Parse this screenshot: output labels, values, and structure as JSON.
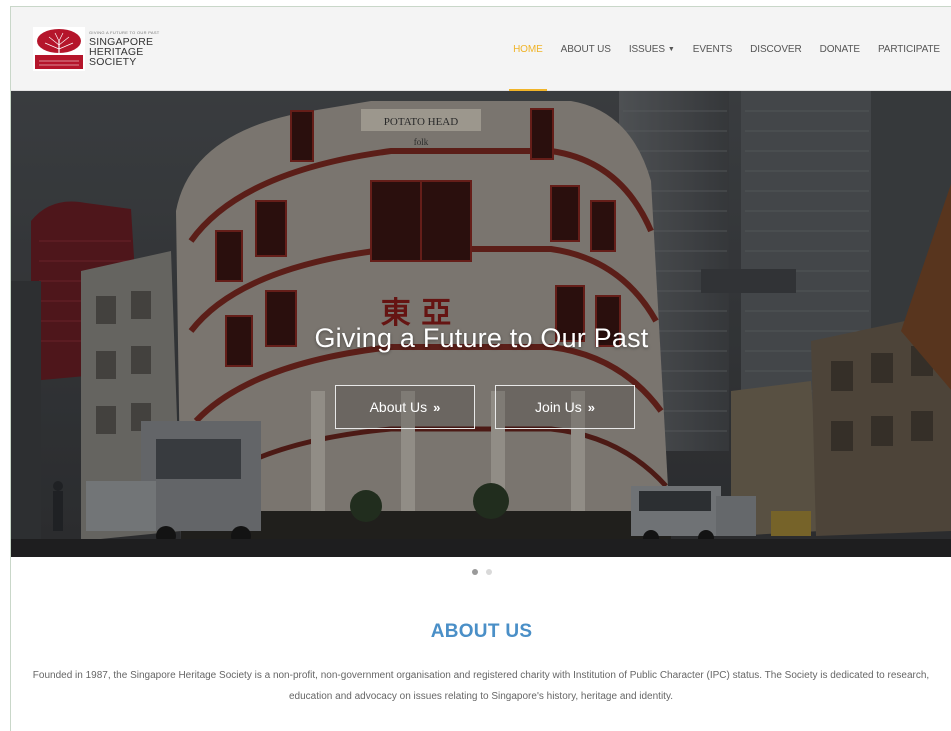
{
  "header": {
    "logo": {
      "tagline": "GIVING A FUTURE TO OUR PAST",
      "lines": [
        "SINGAPORE",
        "HERITAGE",
        "SOCIETY"
      ]
    },
    "nav": [
      {
        "label": "HOME",
        "active": true
      },
      {
        "label": "ABOUT US",
        "active": false
      },
      {
        "label": "ISSUES",
        "active": false,
        "has_dropdown": true
      },
      {
        "label": "EVENTS",
        "active": false
      },
      {
        "label": "DISCOVER",
        "active": false
      },
      {
        "label": "DONATE",
        "active": false
      },
      {
        "label": "PARTICIPATE",
        "active": false
      }
    ]
  },
  "hero": {
    "title": "Giving a Future to Our Past",
    "buttons": {
      "about": "About Us",
      "join": "Join Us"
    },
    "signs": {
      "shop": "POTATO HEAD",
      "shop_sub": "folk",
      "chinese": "東 亞"
    },
    "slides": 2,
    "active_slide": 1
  },
  "about": {
    "heading": "ABOUT US",
    "text": "Founded in 1987, the Singapore Heritage Society is a non-profit, non-government organisation and registered charity with Institution of Public Character (IPC) status. The Society is dedicated to research, education and advocacy on issues relating to Singapore's history, heritage and identity."
  },
  "colors": {
    "accent": "#f0b429",
    "heading_blue": "#4a8fc7",
    "logo_red": "#b5152b"
  },
  "icons": {
    "chevrons": "»",
    "dropdown": "caret-down"
  }
}
